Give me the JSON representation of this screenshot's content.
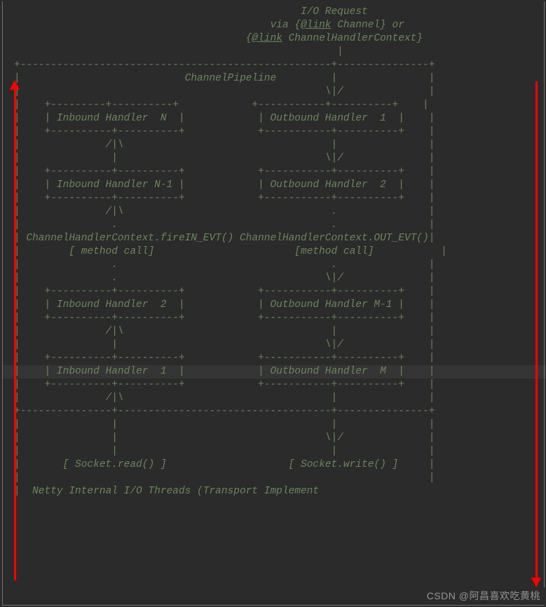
{
  "colors": {
    "bg": "#2b2b2b",
    "fg": "#6a8759",
    "arrow": "#ff0000",
    "watermark": "#c8c8c8"
  },
  "header": {
    "title": "I/O Request",
    "via_open": "via {",
    "link1_at": "@link",
    "link1_obj": " Channel",
    "via_mid": "} or",
    "link2_open": "{",
    "link2_at": "@link",
    "link2_obj": " ChannelHandlerContext",
    "link2_close": "}"
  },
  "pipeline_title": "ChannelPipeline",
  "inbound": {
    "h_n": "| Inbound Handler  N  |",
    "h_nm1": "| Inbound Handler N-1 |",
    "h_2": "| Inbound Handler  2  |",
    "h_1": "| Inbound Handler  1  |",
    "ctx": "ChannelHandlerContext.fireIN_EVT()",
    "call": "[ method call]",
    "socket": "[ Socket.read() ]"
  },
  "outbound": {
    "h_1": "| Outbound Handler  1  |",
    "h_2": "| Outbound Handler  2  |",
    "h_mm1": "| Outbound Handler M-1 |",
    "h_m": "| Outbound Handler  M  |",
    "ctx": "ChannelHandlerContext.OUT_EVT()",
    "call": "[method call]",
    "socket": "[ Socket.write() ]"
  },
  "art": {
    "top": "+---------------------------------------------------+---------------+",
    "pipe": "|                                                  \\|/              |",
    "box": "+---------+----------+                    +-----------+----------+",
    "updn1": "|               /|\\                                  |               |",
    "mid": "|                |                                  \\|/              |",
    "dot": "|                .                                   .               |",
    "updn2": "|        .               .                   .               .       |",
    "updn3": "|       [ method call]                       [method call]         |",
    "pipe2": "|                |                                   |               |",
    "sep": "+---------+-------------------------------------------+---------------+",
    "bottom": "+-------------------------------------------------------------------+"
  },
  "footer": {
    "threads": "|  Netty Internal I/O Threads (Transport Implement"
  },
  "watermark": "CSDN @阿昌喜欢吃黄桃"
}
